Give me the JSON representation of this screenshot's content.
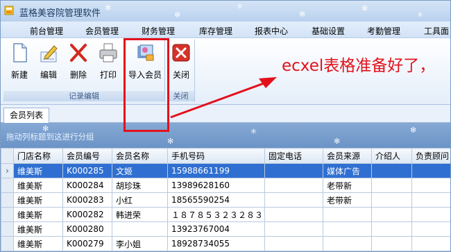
{
  "window": {
    "title": "蓝格美容院管理软件"
  },
  "menu": [
    "前台管理",
    "会员管理",
    "财务管理",
    "库存管理",
    "报表中心",
    "基础设置",
    "考勤管理",
    "工具面"
  ],
  "ribbon": {
    "groups": [
      {
        "label": "记录编辑",
        "buttons": [
          "新建",
          "编辑",
          "删除",
          "打印",
          "导入会员"
        ]
      },
      {
        "label": "关闭",
        "buttons": [
          "关闭"
        ]
      }
    ]
  },
  "annotation": {
    "text": "ecxel表格准备好了，"
  },
  "tabs": {
    "active": "会员列表"
  },
  "group_panel": {
    "hint": "拖动列标题到这进行分组"
  },
  "table": {
    "columns": [
      "门店名称",
      "会员编号",
      "会员名称",
      "手机号码",
      "固定电话",
      "会员来源",
      "介绍人",
      "负责顾问"
    ],
    "rows": [
      [
        "维美斯",
        "K000285",
        "文姬",
        "15988661199",
        "",
        "媒体广告",
        "",
        ""
      ],
      [
        "维美斯",
        "K000284",
        "胡珍珠",
        "13989628160",
        "",
        "老带新",
        "",
        ""
      ],
      [
        "维美斯",
        "K000283",
        "小红",
        "18565590254",
        "",
        "老带新",
        "",
        ""
      ],
      [
        "维美斯",
        "K000282",
        "韩进荣",
        "１８７８５３２３２８３",
        "",
        "",
        "",
        ""
      ],
      [
        "维美斯",
        "K000280",
        "",
        "13923767004",
        "",
        "",
        "",
        ""
      ],
      [
        "维美斯",
        "K000279",
        "李小姐",
        "18928734055",
        "",
        "",
        "",
        ""
      ]
    ],
    "selected_row": 0,
    "row_indicator": "›"
  },
  "colors": {
    "accent_red": "#e3101a",
    "selection": "#2f6fd1"
  }
}
